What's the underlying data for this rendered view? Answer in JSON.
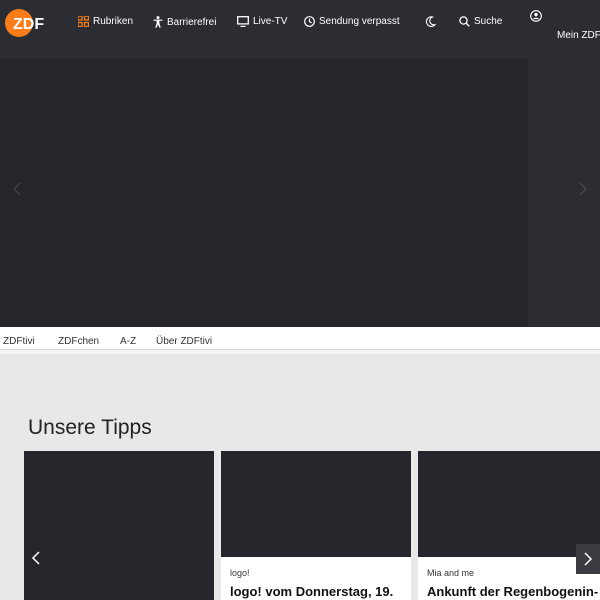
{
  "header": {
    "logo_text": "ZDF",
    "nav": {
      "rubriken": "Rubriken",
      "barrierefrei": "Barrierefrei",
      "live_tv": "Live-TV",
      "sendung_verpasst": "Sendung verpasst",
      "suche": "Suche"
    },
    "mein_zdf": "Mein ZDF"
  },
  "colors": {
    "brand": "#fa7d19",
    "header_bg": "#2b2d33",
    "hero_bg": "#25262b"
  },
  "subnav": [
    "ZDFtivi",
    "ZDFchen",
    "A-Z",
    "Über ZDFtivi"
  ],
  "section": {
    "title": "Unsere Tipps",
    "cards": [
      {
        "meta": "",
        "title": ""
      },
      {
        "meta": "logo!",
        "title": "logo! vom Donnerstag, 19."
      },
      {
        "meta": "Mia and me",
        "title": "Ankunft der Regenbogenin-"
      }
    ]
  }
}
